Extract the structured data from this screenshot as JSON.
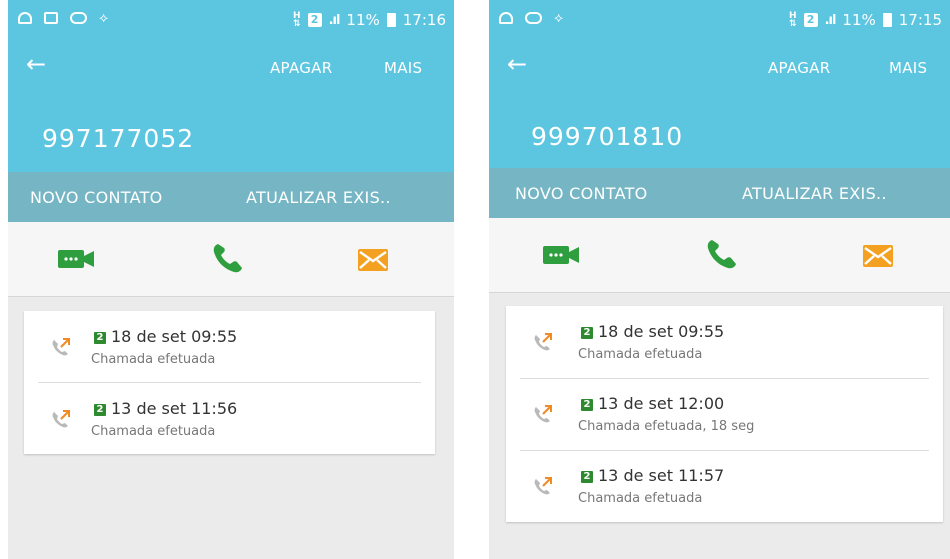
{
  "screens": [
    {
      "status": {
        "sim": "2",
        "battery": "11%",
        "time": "17:16"
      },
      "header": {
        "back_icon": "arrow-left-icon",
        "delete_label": "APAGAR",
        "more_label": "MAIS",
        "phone_number": "997177052"
      },
      "contact_bar": {
        "new_contact": "NOVO CONTATO",
        "update_existing": "ATUALIZAR EXIS.."
      },
      "actions": {
        "video_icon": "video-call-icon",
        "call_icon": "phone-icon",
        "message_icon": "envelope-icon"
      },
      "calls": [
        {
          "sim": "2",
          "datetime": "18 de set 09:55",
          "detail": "Chamada efetuada"
        },
        {
          "sim": "2",
          "datetime": "13 de set 11:56",
          "detail": "Chamada efetuada"
        }
      ]
    },
    {
      "status": {
        "sim": "2",
        "battery": "11%",
        "time": "17:15"
      },
      "header": {
        "back_icon": "arrow-left-icon",
        "delete_label": "APAGAR",
        "more_label": "MAIS",
        "phone_number": "999701810"
      },
      "contact_bar": {
        "new_contact": "NOVO CONTATO",
        "update_existing": "ATUALIZAR EXIS.."
      },
      "actions": {
        "video_icon": "video-call-icon",
        "call_icon": "phone-icon",
        "message_icon": "envelope-icon"
      },
      "calls": [
        {
          "sim": "2",
          "datetime": "18 de set 09:55",
          "detail": "Chamada efetuada"
        },
        {
          "sim": "2",
          "datetime": "13 de set 12:00",
          "detail": "Chamada efetuada, 18 seg"
        },
        {
          "sim": "2",
          "datetime": "13 de set 11:57",
          "detail": "Chamada efetuada"
        }
      ]
    }
  ],
  "colors": {
    "header": "#5cc6e0",
    "contact_bar": "#76b6c4",
    "video": "#2e9e3e",
    "call": "#2e9e3e",
    "message": "#f4a020",
    "outgoing_arrow": "#f08a24"
  }
}
